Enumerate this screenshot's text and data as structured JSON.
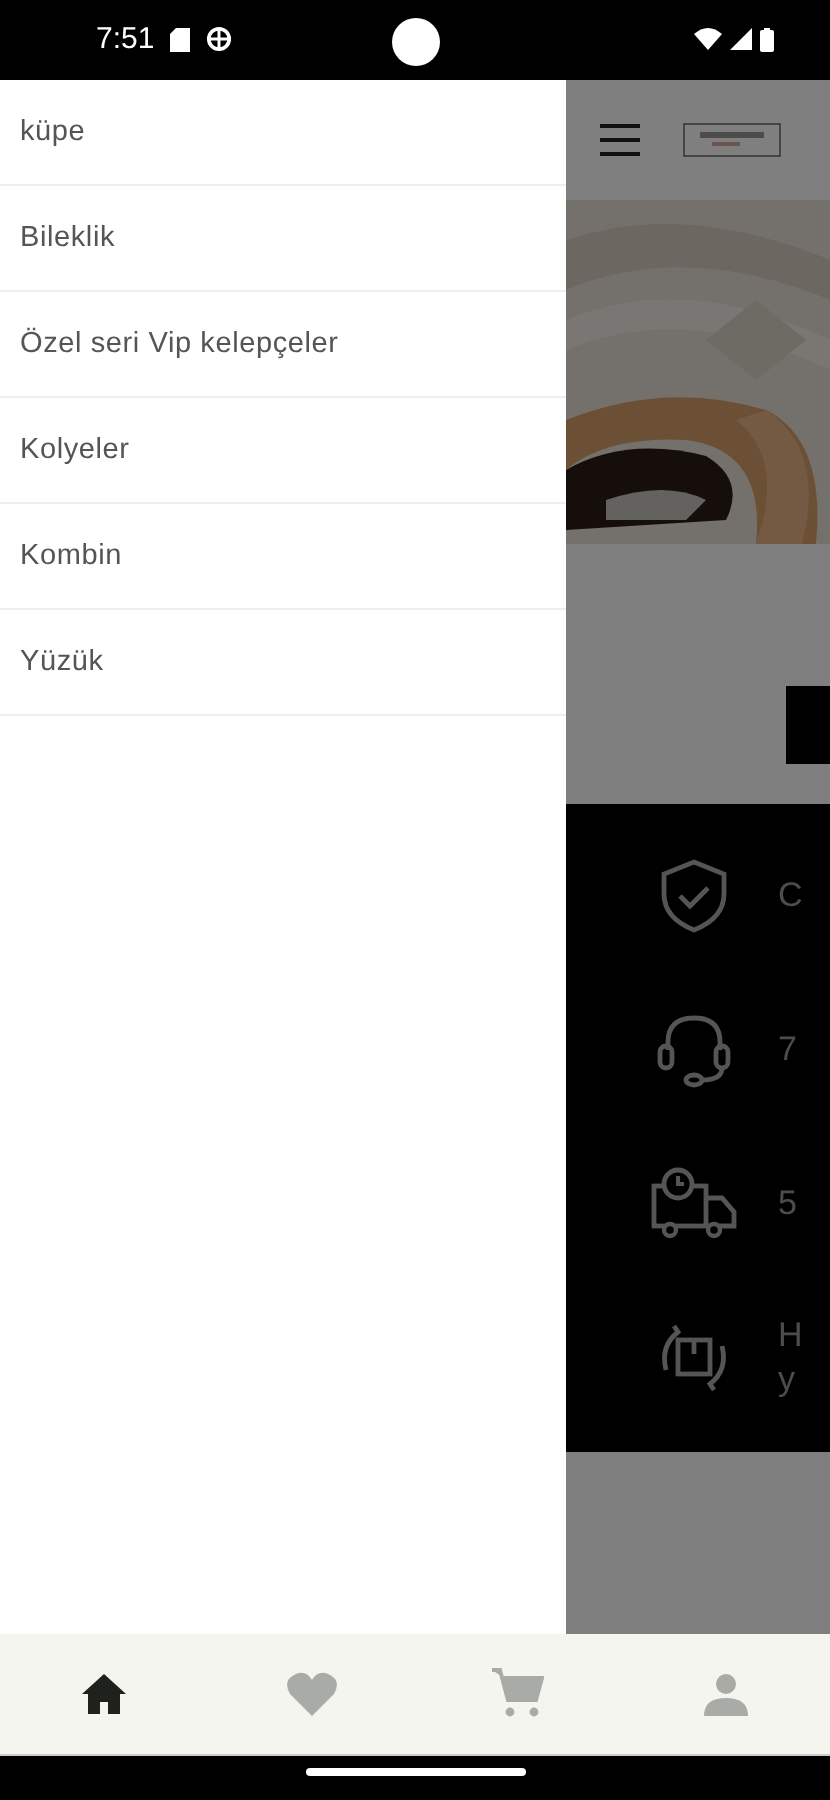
{
  "status_bar": {
    "time": "7:51"
  },
  "drawer": {
    "items": [
      {
        "label": "küpe"
      },
      {
        "label": "Bileklik"
      },
      {
        "label": "Özel seri Vip kelepçeler"
      },
      {
        "label": "Kolyeler"
      },
      {
        "label": "Kombin"
      },
      {
        "label": "Yüzük"
      }
    ]
  },
  "page": {
    "features": [
      {
        "kind": "shield",
        "lines": [
          "C"
        ]
      },
      {
        "kind": "headset",
        "lines": [
          "7"
        ]
      },
      {
        "kind": "truck",
        "lines": [
          "5"
        ]
      },
      {
        "kind": "return",
        "lines": [
          "H",
          "y"
        ]
      }
    ]
  },
  "bottom_nav": [
    {
      "kind": "home",
      "selected": true
    },
    {
      "kind": "heart",
      "selected": false
    },
    {
      "kind": "cart",
      "selected": false
    },
    {
      "kind": "person",
      "selected": false
    }
  ]
}
